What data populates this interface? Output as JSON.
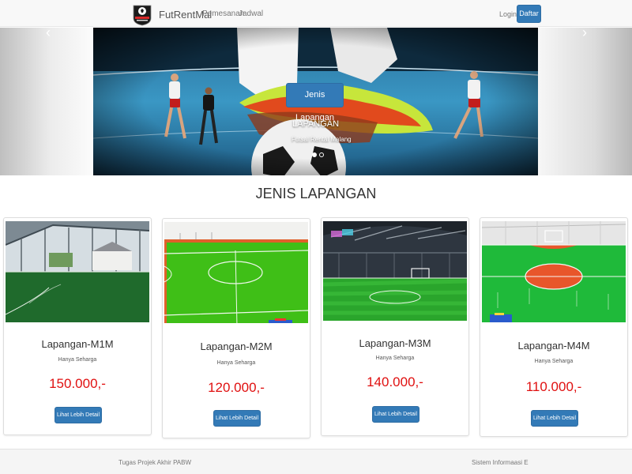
{
  "navbar": {
    "brand": "FutRentMal",
    "links": [
      "Pemesanan",
      "Jadwal"
    ],
    "login": "Login",
    "register": "Daftar"
  },
  "hero": {
    "button": "Jenis Lapangan",
    "caption_title": "LAPANGAN",
    "caption_subtitle": "Futsal Rental Malang",
    "controls": {
      "prev": "‹",
      "next": "›"
    },
    "slides": 2,
    "active_slide": 1
  },
  "section": {
    "title": "JENIS LAPANGAN"
  },
  "fields": [
    {
      "name": "Lapangan-M1M",
      "tag": "Hanya Seharga",
      "price": "150.000,-",
      "button": "Lihat Lebih Detail"
    },
    {
      "name": "Lapangan-M2M",
      "tag": "Hanya Seharga",
      "price": "120.000,-",
      "button": "Lihat Lebih Detail"
    },
    {
      "name": "Lapangan-M3M",
      "tag": "Hanya Seharga",
      "price": "140.000,-",
      "button": "Lihat Lebih Detail"
    },
    {
      "name": "Lapangan-M4M",
      "tag": "Hanya Seharga",
      "price": "110.000,-",
      "button": "Lihat Lebih Detail"
    }
  ],
  "footer": {
    "left": "Tugas Projek Akhir PABW",
    "right": "Sistem Informaasi E"
  },
  "colors": {
    "primary": "#337ab7",
    "price": "#e01010",
    "field_green": "#39c21a"
  }
}
